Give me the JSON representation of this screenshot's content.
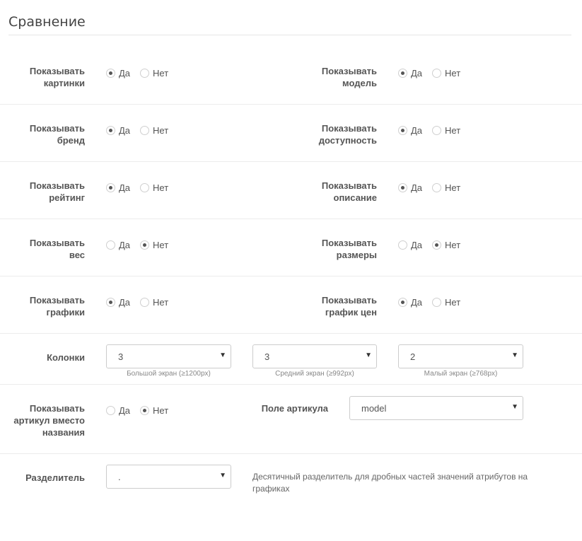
{
  "section": {
    "title": "Сравнение"
  },
  "radio_rows": [
    {
      "left": {
        "label": "Показывать картинки",
        "options": [
          "Да",
          "Нет"
        ],
        "selected": "Да"
      },
      "right": {
        "label": "Показывать модель",
        "options": [
          "Да",
          "Нет"
        ],
        "selected": "Да"
      }
    },
    {
      "left": {
        "label": "Показывать бренд",
        "options": [
          "Да",
          "Нет"
        ],
        "selected": "Да"
      },
      "right": {
        "label": "Показывать доступность",
        "options": [
          "Да",
          "Нет"
        ],
        "selected": "Да"
      }
    },
    {
      "left": {
        "label": "Показывать рейтинг",
        "options": [
          "Да",
          "Нет"
        ],
        "selected": "Да"
      },
      "right": {
        "label": "Показывать описание",
        "options": [
          "Да",
          "Нет"
        ],
        "selected": "Да"
      }
    },
    {
      "left": {
        "label": "Показывать вес",
        "options": [
          "Да",
          "Нет"
        ],
        "selected": "Нет"
      },
      "right": {
        "label": "Показывать размеры",
        "options": [
          "Да",
          "Нет"
        ],
        "selected": "Нет"
      }
    },
    {
      "left": {
        "label": "Показывать графики",
        "options": [
          "Да",
          "Нет"
        ],
        "selected": "Да"
      },
      "right": {
        "label": "Показывать график цен",
        "options": [
          "Да",
          "Нет"
        ],
        "selected": "Да"
      }
    }
  ],
  "columns": {
    "label": "Колонки",
    "selects": [
      {
        "value": "3",
        "help": "Большой экран (≥1200px)"
      },
      {
        "value": "3",
        "help": "Средний экран (≥992px)"
      },
      {
        "value": "2",
        "help": "Малый экран (≥768px)"
      }
    ]
  },
  "sku": {
    "label": "Показывать артикул вместо названия",
    "options": [
      "Да",
      "Нет"
    ],
    "selected": "Нет",
    "field_label": "Поле артикула",
    "field_value": "model"
  },
  "separator": {
    "label": "Разделитель",
    "value": ".",
    "note": "Десятичный разделитель для дробных частей значений атрибутов на графиках"
  },
  "icons": {
    "caret": "caret-down-icon"
  }
}
